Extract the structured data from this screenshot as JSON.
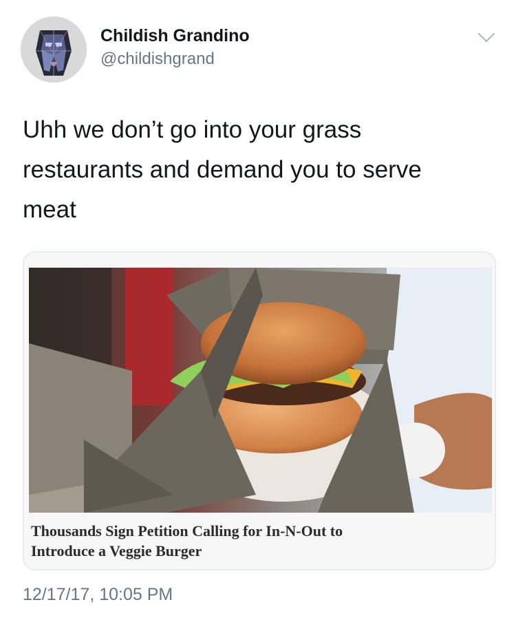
{
  "user": {
    "display_name": "Childish Grandino",
    "handle": "@childishgrand"
  },
  "tweet": {
    "text": "Uhh we don’t go into your grass\nrestaurants and demand you to serve\nmeat",
    "timestamp": "12/17/17, 10:05 PM"
  },
  "card": {
    "headline": "Thousands Sign Petition Calling for In-N-Out to\nIntroduce a Veggie Burger"
  },
  "icons": {
    "menu": "chevron-down-icon",
    "avatar": "avatar-image"
  },
  "colors": {
    "primary_text": "#14171a",
    "secondary_text": "#657786",
    "card_border": "#e6ecf0"
  }
}
